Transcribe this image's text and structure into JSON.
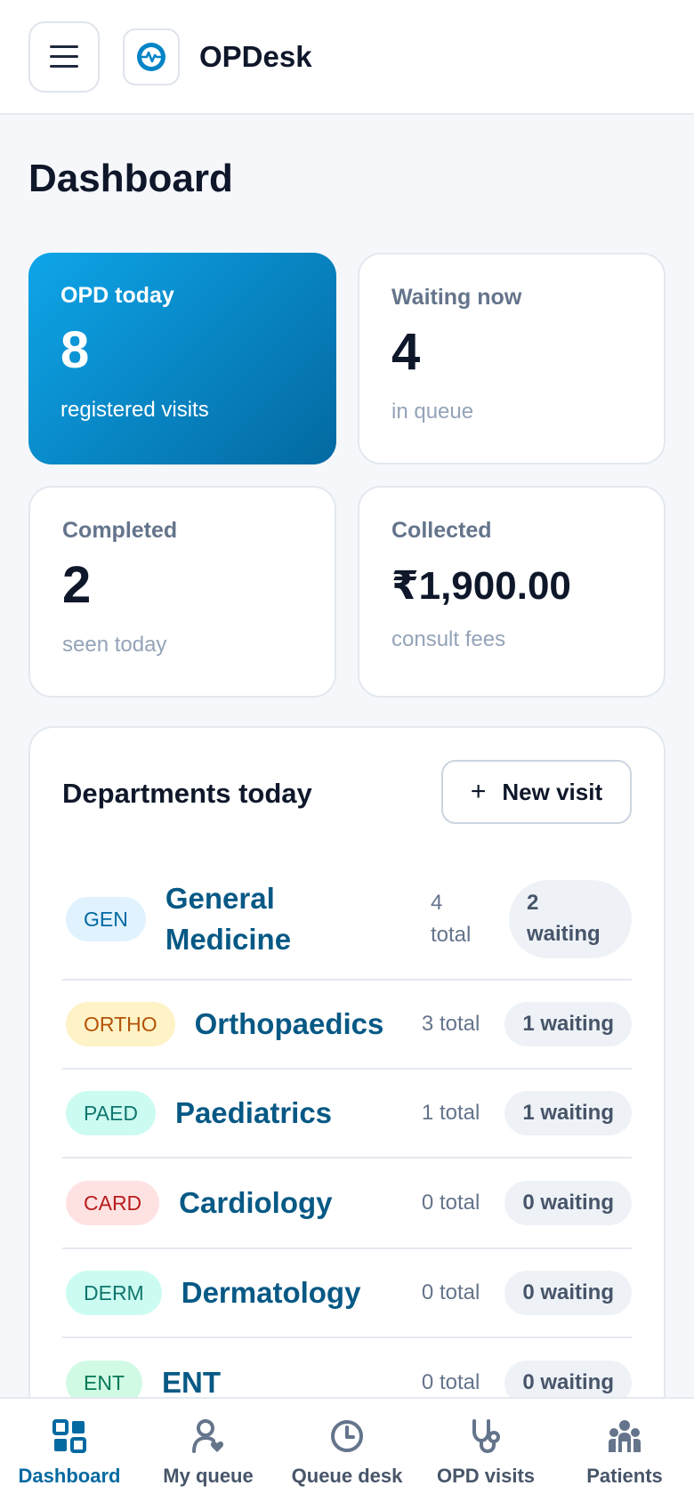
{
  "header": {
    "app_title": "OPDesk",
    "menu_icon": "hamburger-menu-icon",
    "logo_icon": "pulse-logo-icon"
  },
  "page_title": "Dashboard",
  "stats": {
    "opd_today": {
      "label": "OPD today",
      "value": "8",
      "sub": "registered visits"
    },
    "waiting_now": {
      "label": "Waiting now",
      "value": "4",
      "sub": "in queue"
    },
    "completed": {
      "label": "Completed",
      "value": "2",
      "sub": "seen today"
    },
    "collected": {
      "label": "Collected",
      "value": "₹1,900.00",
      "sub": "consult fees"
    }
  },
  "departments": {
    "title": "Departments today",
    "new_visit_label": "New visit",
    "items": [
      {
        "code": "GEN",
        "name": "General Medicine",
        "total": "4 total",
        "waiting": "2 waiting",
        "badge_bg": "#e0f2fe",
        "badge_fg": "#0369a1"
      },
      {
        "code": "ORTHO",
        "name": "Orthopaedics",
        "total": "3 total",
        "waiting": "1 waiting",
        "badge_bg": "#fef3c7",
        "badge_fg": "#b45309"
      },
      {
        "code": "PAED",
        "name": "Paediatrics",
        "total": "1 total",
        "waiting": "1 waiting",
        "badge_bg": "#ccfbf1",
        "badge_fg": "#0f766e"
      },
      {
        "code": "CARD",
        "name": "Cardiology",
        "total": "0 total",
        "waiting": "0 waiting",
        "badge_bg": "#fee2e2",
        "badge_fg": "#b91c1c"
      },
      {
        "code": "DERM",
        "name": "Dermatology",
        "total": "0 total",
        "waiting": "0 waiting",
        "badge_bg": "#ccfbf1",
        "badge_fg": "#0f766e"
      },
      {
        "code": "ENT",
        "name": "ENT",
        "total": "0 total",
        "waiting": "0 waiting",
        "badge_bg": "#d1fae5",
        "badge_fg": "#047857"
      }
    ]
  },
  "bottom_nav": [
    {
      "label": "Dashboard",
      "icon": "dashboard-grid-icon",
      "active": true
    },
    {
      "label": "My queue",
      "icon": "user-heart-icon",
      "active": false
    },
    {
      "label": "Queue desk",
      "icon": "clock-icon",
      "active": false
    },
    {
      "label": "OPD visits",
      "icon": "stethoscope-icon",
      "active": false
    },
    {
      "label": "Patients",
      "icon": "people-group-icon",
      "active": false
    }
  ],
  "colors": {
    "accent": "#0369a1",
    "accent_light": "#0ea5e9",
    "text": "#0f172a",
    "muted": "#64748b"
  }
}
